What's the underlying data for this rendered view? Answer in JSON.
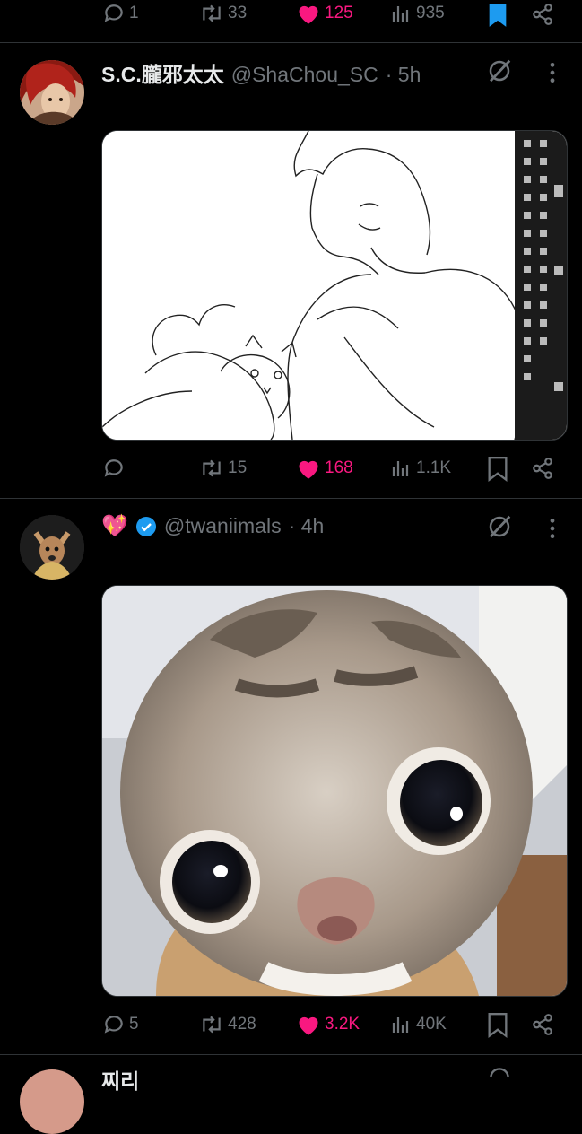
{
  "colors": {
    "background": "#000000",
    "like": "#f91880",
    "bookmark": "#1d9bf0",
    "muted": "#71767b",
    "text": "#e7e9ea",
    "verified": "#1d9bf0"
  },
  "top_actions": {
    "replies": "1",
    "reposts": "33",
    "likes": "125",
    "views": "935",
    "liked": true,
    "bookmarked": true
  },
  "tweets": [
    {
      "display_name": "S.C.朧邪太太",
      "handle": "@ShaChou_SC",
      "time": "· 5h",
      "media_icon": "lineart-sketch-image",
      "actions": {
        "replies": "",
        "reposts": "15",
        "likes": "168",
        "views": "1.1K",
        "liked": true
      }
    },
    {
      "display_name_emoji": "💖",
      "verified": true,
      "handle": "@twaniimals",
      "time": "· 4h",
      "media_icon": "kitten-closeup-photo",
      "actions": {
        "replies": "5",
        "reposts": "428",
        "likes": "3.2K",
        "views": "40K",
        "liked": true
      }
    }
  ],
  "partial_next": {
    "display_name": "찌리"
  }
}
